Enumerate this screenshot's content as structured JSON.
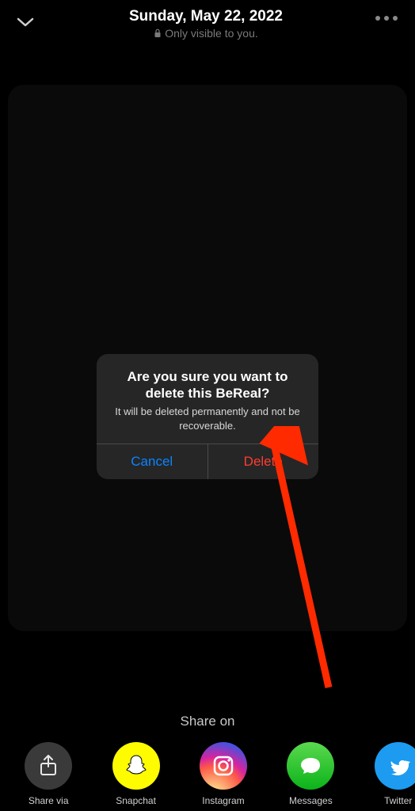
{
  "header": {
    "date": "Sunday, May 22, 2022",
    "visibility": "Only visible to you."
  },
  "dialog": {
    "title": "Are you sure you want to delete this BeReal?",
    "message": "It will be deleted permanently and not be recoverable.",
    "cancel": "Cancel",
    "delete": "Delete"
  },
  "share": {
    "title": "Share on",
    "items": [
      {
        "label": "Share via"
      },
      {
        "label": "Snapchat"
      },
      {
        "label": "Instagram"
      },
      {
        "label": "Messages"
      },
      {
        "label": "Twitter"
      }
    ]
  }
}
